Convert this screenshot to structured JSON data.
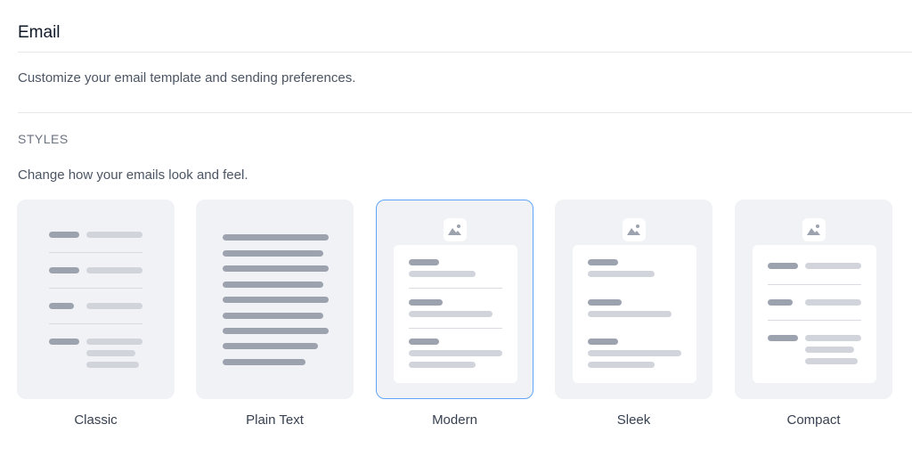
{
  "header": {
    "title": "Email",
    "description": "Customize your email template and sending preferences."
  },
  "styles": {
    "section_label": "STYLES",
    "description": "Change how your emails look and feel.",
    "selected": "Modern",
    "options": [
      {
        "label": "Classic"
      },
      {
        "label": "Plain Text"
      },
      {
        "label": "Modern"
      },
      {
        "label": "Sleek"
      },
      {
        "label": "Compact"
      }
    ]
  },
  "colors": {
    "selected_border": "#60a5fa",
    "card_background": "#f1f2f5",
    "placeholder_dark": "#9ca3af",
    "placeholder_light": "#d1d5db"
  },
  "icons": [
    "image-icon"
  ]
}
